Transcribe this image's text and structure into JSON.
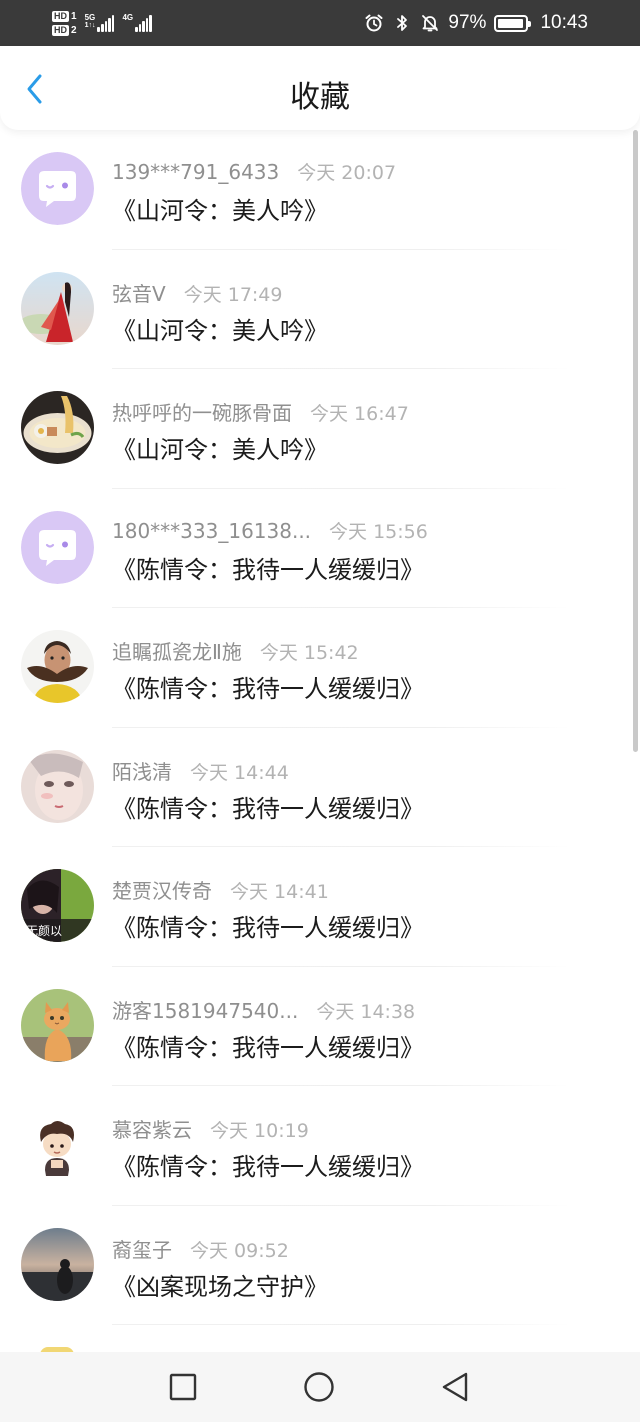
{
  "status_bar": {
    "hd1": "HD",
    "hd1_num": "1",
    "hd2": "HD",
    "hd2_num": "2",
    "net1_top": "5G",
    "net1_bottom": "1↑↓",
    "net2": "4G",
    "battery_percent": "97%",
    "time": "10:43",
    "icons": [
      "alarm-icon",
      "bluetooth-icon",
      "mute-icon",
      "battery-icon"
    ]
  },
  "header": {
    "title": "收藏",
    "back_icon": "chevron-left-icon"
  },
  "colors": {
    "accent": "#2a9ce8",
    "status_bar_bg": "#3a3a3a",
    "default_avatar_bg": "#d9c8f5",
    "name_text": "#8f8f8f",
    "time_text": "#b3b3b3"
  },
  "items": [
    {
      "name": "139***791_6433",
      "time": "今天 20:07",
      "work": "《山河令：美人吟》",
      "avatar": "default"
    },
    {
      "name": "弦音V",
      "time": "今天 17:49",
      "work": "《山河令：美人吟》",
      "avatar": "photo"
    },
    {
      "name": "热呼呼的一碗豚骨面",
      "time": "今天 16:47",
      "work": "《山河令：美人吟》",
      "avatar": "photo"
    },
    {
      "name": "180***333_16138...",
      "time": "今天 15:56",
      "work": "《陈情令：我待一人缓缓归》",
      "avatar": "default"
    },
    {
      "name": "追瞩孤瓷龙Ⅱ施",
      "time": "今天 15:42",
      "work": "《陈情令：我待一人缓缓归》",
      "avatar": "photo"
    },
    {
      "name": "陌浅清",
      "time": "今天 14:44",
      "work": "《陈情令：我待一人缓缓归》",
      "avatar": "photo"
    },
    {
      "name": "楚贾汉传奇",
      "time": "今天 14:41",
      "work": "《陈情令：我待一人缓缓归》",
      "avatar": "photo",
      "avatar_caption": "无颜以"
    },
    {
      "name": "游客1581947540...",
      "time": "今天 14:38",
      "work": "《陈情令：我待一人缓缓归》",
      "avatar": "photo"
    },
    {
      "name": "慕容紫云",
      "time": "今天 10:19",
      "work": "《陈情令：我待一人缓缓归》",
      "avatar": "cartoon"
    },
    {
      "name": "裔玺子",
      "time": "今天 09:52",
      "work": "《凶案现场之守护》",
      "avatar": "photo"
    }
  ],
  "nav_bar": {
    "icons": [
      "square-recents-icon",
      "circle-home-icon",
      "triangle-back-icon"
    ]
  }
}
